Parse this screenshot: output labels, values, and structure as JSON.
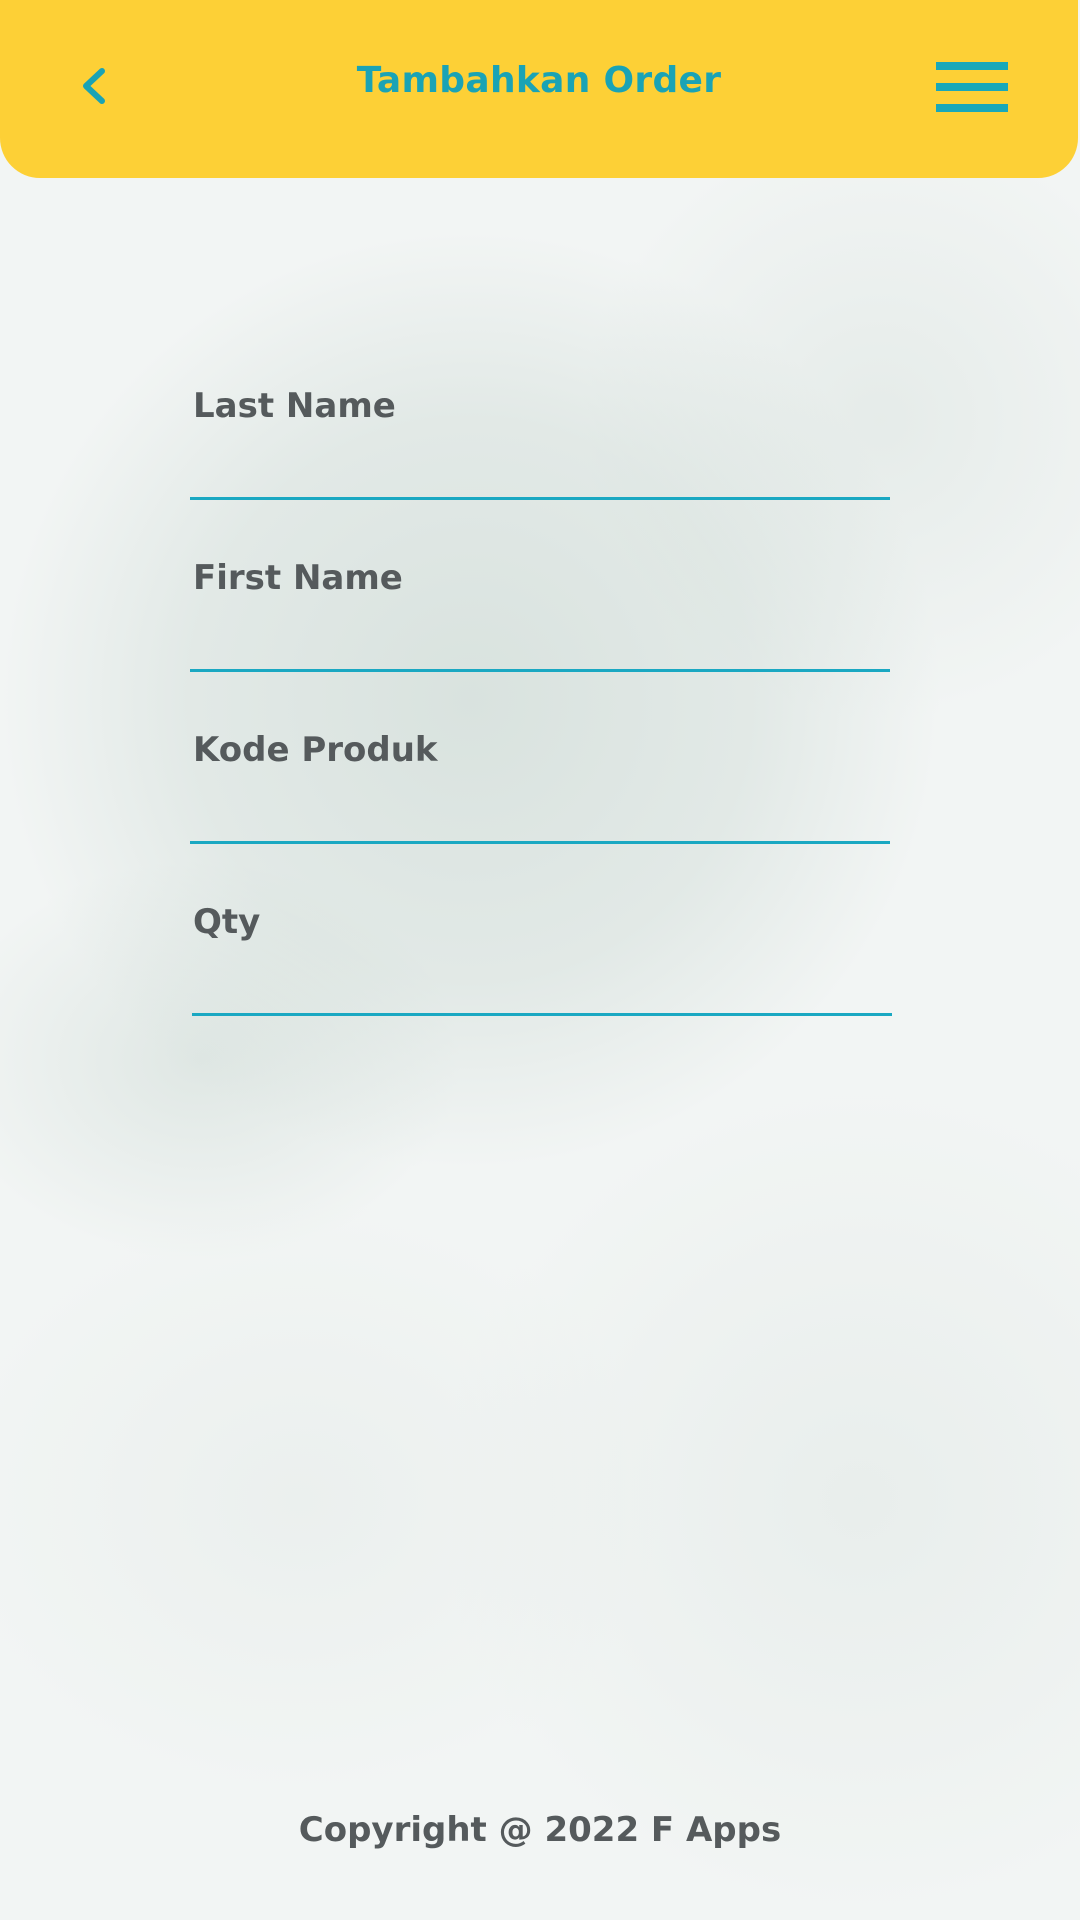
{
  "header": {
    "title": "Tambahkan Order",
    "back_icon": "chevron-left-icon",
    "menu_icon": "hamburger-menu-icon",
    "background_color": "#fdd036",
    "accent_color": "#1aa3b5"
  },
  "form": {
    "fields": [
      {
        "label": "Last Name",
        "value": ""
      },
      {
        "label": "First Name",
        "value": ""
      },
      {
        "label": "Kode Produk",
        "value": ""
      },
      {
        "label": "Qty",
        "value": ""
      }
    ],
    "underline_color": "#1aa8c2"
  },
  "footer": {
    "copyright": "Copyright @ 2022 F Apps"
  }
}
